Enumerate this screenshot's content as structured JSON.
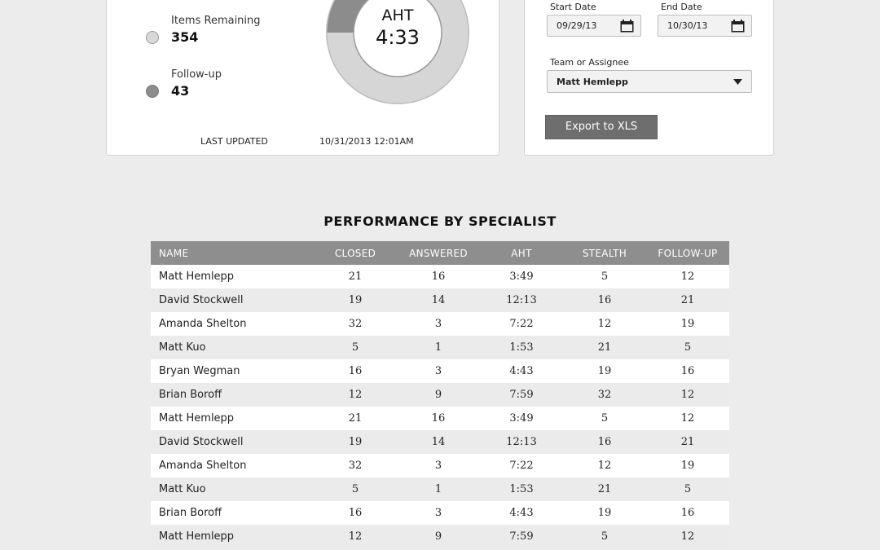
{
  "summary": {
    "legend": [
      {
        "label": "Items Remaining",
        "value": "354"
      },
      {
        "label": "Follow-up",
        "value": "43"
      }
    ],
    "aht": {
      "label": "AHT",
      "value": "4:33"
    },
    "last_updated_label": "LAST UPDATED",
    "last_updated_value": "10/31/2013  12:01AM"
  },
  "filters": {
    "start_date_label": "Start Date",
    "start_date_value": "09/29/13",
    "end_date_label": "End Date",
    "end_date_value": "10/30/13",
    "team_label": "Team or Assignee",
    "team_value": "Matt Hemlepp",
    "export_label": "Export to XLS"
  },
  "icons": {
    "calendar": "calendar-icon",
    "caret": "caret-down-icon"
  },
  "colors": {
    "header_bg": "#8e8e8e",
    "button_bg": "#6e6e6e",
    "donut_light": "#d6d6d6",
    "donut_dark": "#8c8c8c"
  },
  "table": {
    "title": "PERFORMANCE BY SPECIALIST",
    "columns": [
      "NAME",
      "CLOSED",
      "ANSWERED",
      "AHT",
      "STEALTH",
      "FOLLOW-UP"
    ],
    "rows": [
      [
        "Matt Hemlepp",
        "21",
        "16",
        "3:49",
        "5",
        "12"
      ],
      [
        "David Stockwell",
        "19",
        "14",
        "12:13",
        "16",
        "21"
      ],
      [
        "Amanda Shelton",
        "32",
        "3",
        "7:22",
        "12",
        "19"
      ],
      [
        "Matt Kuo",
        "5",
        "1",
        "1:53",
        "21",
        "5"
      ],
      [
        "Bryan Wegman",
        "16",
        "3",
        "4:43",
        "19",
        "16"
      ],
      [
        "Brian Boroff",
        "12",
        "9",
        "7:59",
        "32",
        "12"
      ],
      [
        "Matt Hemlepp",
        "21",
        "16",
        "3:49",
        "5",
        "12"
      ],
      [
        "David Stockwell",
        "19",
        "14",
        "12:13",
        "16",
        "21"
      ],
      [
        "Amanda Shelton",
        "32",
        "3",
        "7:22",
        "12",
        "19"
      ],
      [
        "Matt Kuo",
        "5",
        "1",
        "1:53",
        "21",
        "5"
      ],
      [
        "Brian Boroff",
        "16",
        "3",
        "4:43",
        "19",
        "16"
      ],
      [
        "Matt Hemlepp",
        "12",
        "9",
        "7:59",
        "5",
        "12"
      ]
    ]
  }
}
